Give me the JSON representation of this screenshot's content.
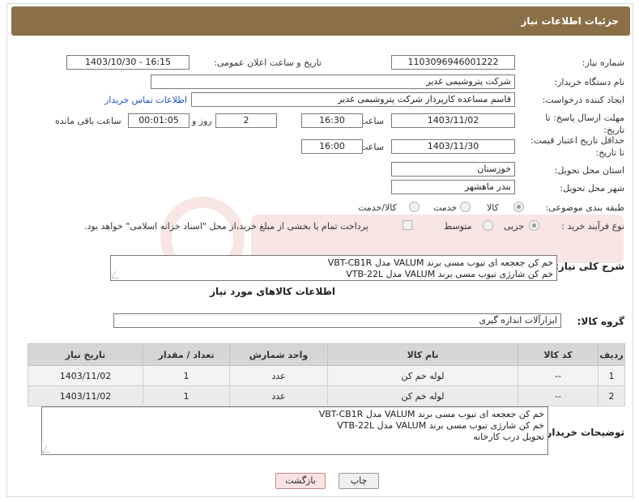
{
  "header": {
    "title": "جزئیات اطلاعات نیاز"
  },
  "fields": {
    "need_number_label": "شماره نیاز:",
    "need_number": "1103096946001222",
    "announce_label": "تاریخ و ساعت اعلان عمومی:",
    "announce_value": "1403/10/30 - 16:15",
    "buyer_org_label": "نام دستگاه خریدار:",
    "buyer_org": "شرکت پتروشیمی غدیر",
    "creator_label": "ایجاد کننده درخواست:",
    "creator": "قاسم مساعده کارپرداز شرکت پتروشیمی غدیر",
    "contact_link": "اطلاعات تماس خریدار",
    "deadline_label": "مهلت ارسال پاسخ: تا تاریخ:",
    "deadline_date": "1403/11/02",
    "time_label": "ساعت",
    "deadline_time": "16:30",
    "days_value": "2",
    "days_label": "روز و",
    "remaining_time": "00:01:05",
    "remaining_label": "ساعت باقی مانده",
    "validity_label": "حداقل تاریخ اعتبار قیمت: تا تاریخ:",
    "validity_date": "1403/11/30",
    "validity_time": "16:00",
    "province_label": "استان محل تحویل:",
    "province": "خوزستان",
    "city_label": "شهر محل تحویل:",
    "city": "بندر ماهشهر",
    "category_label": "طبقه بندی موضوعی:",
    "category_options": [
      "کالا",
      "خدمت",
      "کالا/خدمت"
    ],
    "purchase_label": "نوع فرآیند خرید :",
    "purchase_options": [
      "جزیی",
      "متوسط"
    ],
    "payment_note": "پرداخت تمام یا بخشی از مبلغ خرید،از محل \"اسناد خزانه اسلامی\" خواهد بود."
  },
  "summary": {
    "label": "شرح کلی نیاز:",
    "lines": [
      "خم کن جعجعه ای تیوب مسی برند VALUM مدل VBT-CB1R",
      "خم کن شارژی تیوب مسی برند VALUM مدل VTB-22L"
    ]
  },
  "goods_section": {
    "title": "اطلاعات کالاهای مورد نیاز",
    "group_label": "گروه کالا:",
    "group_value": "ابزارآلات اندازه گیری"
  },
  "table": {
    "headers": [
      "ردیف",
      "کد کالا",
      "نام کالا",
      "واحد شمارش",
      "تعداد / مقدار",
      "تاریخ نیاز"
    ],
    "rows": [
      [
        "1",
        "--",
        "لوله خم کن",
        "عدد",
        "1",
        "1403/11/02"
      ],
      [
        "2",
        "--",
        "لوله خم کن",
        "عدد",
        "1",
        "1403/11/02"
      ]
    ]
  },
  "buyer_notes": {
    "label": "توضیحات خریدار:",
    "lines": [
      "خم کن جعجعه ای تیوب مسی برند VALUM مدل VBT-CB1R",
      "خم کن شارژی تیوب مسی برند VALUM مدل VTB-22L",
      "تحویل درب کارخانه"
    ]
  },
  "buttons": {
    "print": "چاپ",
    "back": "بازگشت"
  },
  "colors": {
    "header_bg": "#8b6f47",
    "link": "#1a57c9",
    "back_btn": "#fbe3e3"
  }
}
